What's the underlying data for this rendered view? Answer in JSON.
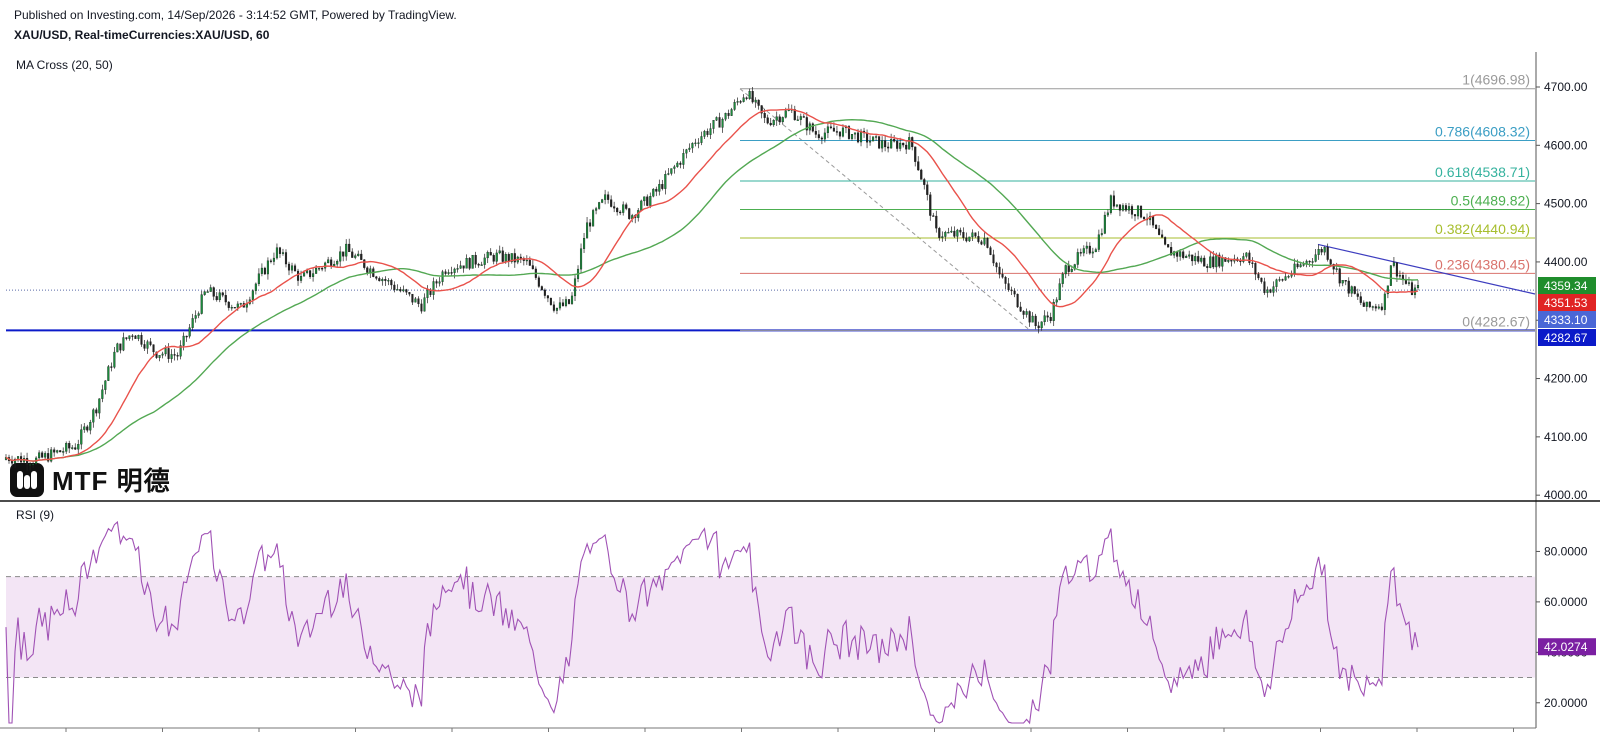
{
  "header": {
    "published": "Published on Investing.com, 14/Sep/2026 - 3:14:52 GMT, Powered by TradingView.",
    "symbol": "XAU/USD, Real-timeCurrencies:XAU/USD, 60"
  },
  "indicators": {
    "ma_label": "MA Cross (20, 50)",
    "rsi_label": "RSI (9)"
  },
  "logo": {
    "text": "MTF 明德"
  },
  "colors": {
    "up": "#1b8a3c",
    "down": "#222222",
    "ma_fast": "#e9524b",
    "ma_slow": "#53a853",
    "rsi": "#a052b5",
    "rsi_band": "#f3e5f5",
    "support": "#0b1ac9",
    "trendline": "#3d3dbf"
  },
  "chart_data": [
    {
      "type": "candlestick",
      "title": "XAU/USD, 60",
      "ylim": [
        3990,
        4760
      ],
      "y_ticks": [
        4000,
        4100,
        4200,
        4300,
        4400,
        4500,
        4600,
        4700
      ],
      "y_tick_labels": [
        "4000.00",
        "4100.00",
        "4200.00",
        "4300.00",
        "4400.00",
        "4500.00",
        "4600.00",
        "4700.00"
      ],
      "price_path": [
        [
          0,
          4065
        ],
        [
          30,
          4060
        ],
        [
          70,
          4085
        ],
        [
          90,
          4150
        ],
        [
          110,
          4250
        ],
        [
          127,
          4280
        ],
        [
          150,
          4245
        ],
        [
          172,
          4240
        ],
        [
          200,
          4350
        ],
        [
          235,
          4320
        ],
        [
          270,
          4420
        ],
        [
          295,
          4370
        ],
        [
          340,
          4420
        ],
        [
          370,
          4380
        ],
        [
          415,
          4325
        ],
        [
          440,
          4390
        ],
        [
          490,
          4410
        ],
        [
          520,
          4400
        ],
        [
          550,
          4320
        ],
        [
          565,
          4330
        ],
        [
          580,
          4460
        ],
        [
          600,
          4510
        ],
        [
          625,
          4480
        ],
        [
          650,
          4520
        ],
        [
          690,
          4610
        ],
        [
          720,
          4650
        ],
        [
          740,
          4692
        ],
        [
          760,
          4640
        ],
        [
          785,
          4660
        ],
        [
          810,
          4620
        ],
        [
          835,
          4625
        ],
        [
          880,
          4600
        ],
        [
          905,
          4605
        ],
        [
          918,
          4530
        ],
        [
          930,
          4450
        ],
        [
          980,
          4440
        ],
        [
          995,
          4370
        ],
        [
          1030,
          4290
        ],
        [
          1045,
          4310
        ],
        [
          1060,
          4390
        ],
        [
          1090,
          4430
        ],
        [
          1105,
          4505
        ],
        [
          1140,
          4480
        ],
        [
          1160,
          4420
        ],
        [
          1200,
          4400
        ],
        [
          1240,
          4410
        ],
        [
          1260,
          4350
        ],
        [
          1300,
          4400
        ],
        [
          1318,
          4425
        ],
        [
          1335,
          4370
        ],
        [
          1360,
          4320
        ],
        [
          1378,
          4330
        ],
        [
          1385,
          4400
        ],
        [
          1405,
          4350
        ],
        [
          1412,
          4352
        ]
      ],
      "last_close": 4351.53,
      "ma_fast_last": 4333.1,
      "ma_slow_last": 4359.34,
      "support_level": 4282.67,
      "fibonacci": [
        {
          "ratio": 1,
          "label": "1(4696.98)",
          "price": 4696.98,
          "color": "#9a9a9a"
        },
        {
          "ratio": 0.786,
          "label": "0.786(4608.32)",
          "price": 4608.32,
          "color": "#3b9ec4"
        },
        {
          "ratio": 0.618,
          "label": "0.618(4538.71)",
          "price": 4538.71,
          "color": "#35b29e"
        },
        {
          "ratio": 0.5,
          "label": "0.5(4489.82)",
          "price": 4489.82,
          "color": "#4caf50"
        },
        {
          "ratio": 0.382,
          "label": "0.382(4440.94)",
          "price": 4440.94,
          "color": "#a7be2d"
        },
        {
          "ratio": 0.236,
          "label": "0.236(4380.45)",
          "price": 4380.45,
          "color": "#d9736d"
        },
        {
          "ratio": 0,
          "label": "0(4282.67)",
          "price": 4282.67,
          "color": "#9a9a9a"
        }
      ],
      "price_tags": [
        {
          "label": "4359.34",
          "value": 4359.34,
          "color": "#1f8d2c"
        },
        {
          "label": "4351.53",
          "value": 4351.53,
          "color": "#e02424"
        },
        {
          "label": "4333.10",
          "value": 4333.1,
          "color": "#4a67d6"
        },
        {
          "label": "4282.67",
          "value": 4282.67,
          "color": "#0b1ac9"
        }
      ]
    },
    {
      "type": "line",
      "ylim": [
        10,
        100
      ],
      "y_ticks": [
        20,
        40,
        60,
        80
      ],
      "y_tick_labels": [
        "20.0000",
        "40.0000",
        "60.0000",
        "80.0000"
      ],
      "overbought": 70,
      "oversold": 30,
      "last_value": 42.0274,
      "last_label": "42.0274"
    }
  ]
}
